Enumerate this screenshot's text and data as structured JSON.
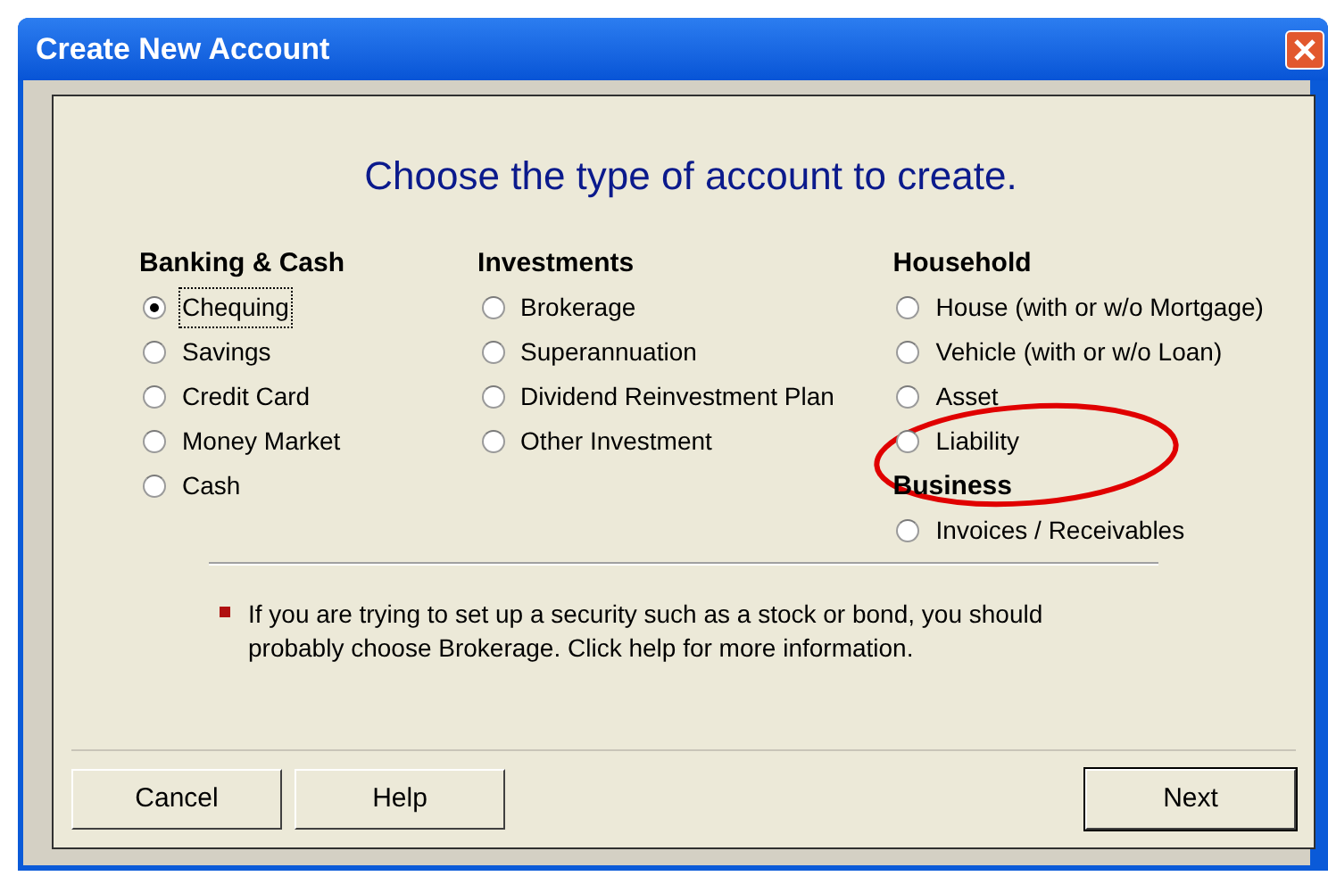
{
  "window": {
    "title": "Create New Account"
  },
  "prompt": "Choose the type of account to create.",
  "columns": [
    {
      "groups": [
        {
          "heading": "Banking & Cash",
          "options": [
            {
              "label": "Chequing",
              "selected": true
            },
            {
              "label": "Savings",
              "selected": false
            },
            {
              "label": "Credit Card",
              "selected": false
            },
            {
              "label": "Money Market",
              "selected": false
            },
            {
              "label": "Cash",
              "selected": false
            }
          ]
        }
      ]
    },
    {
      "groups": [
        {
          "heading": "Investments",
          "options": [
            {
              "label": "Brokerage",
              "selected": false
            },
            {
              "label": "Superannuation",
              "selected": false
            },
            {
              "label": "Dividend Reinvestment Plan",
              "selected": false
            },
            {
              "label": "Other Investment",
              "selected": false
            }
          ]
        }
      ]
    },
    {
      "groups": [
        {
          "heading": "Household",
          "options": [
            {
              "label": "House (with or w/o Mortgage)",
              "selected": false
            },
            {
              "label": "Vehicle (with or w/o Loan)",
              "selected": false
            },
            {
              "label": "Asset",
              "selected": false
            },
            {
              "label": "Liability",
              "selected": false
            }
          ]
        },
        {
          "heading": "Business",
          "options": [
            {
              "label": "Invoices / Receivables",
              "selected": false
            }
          ]
        }
      ]
    }
  ],
  "note": "If you are trying to set up a security such as a stock or bond, you should probably choose Brokerage. Click help for more information.",
  "buttons": {
    "left": [
      "Cancel",
      "Help"
    ],
    "right": [
      "Next"
    ]
  },
  "annotations": [
    {
      "kind": "ellipse",
      "color": "#e00000"
    }
  ]
}
